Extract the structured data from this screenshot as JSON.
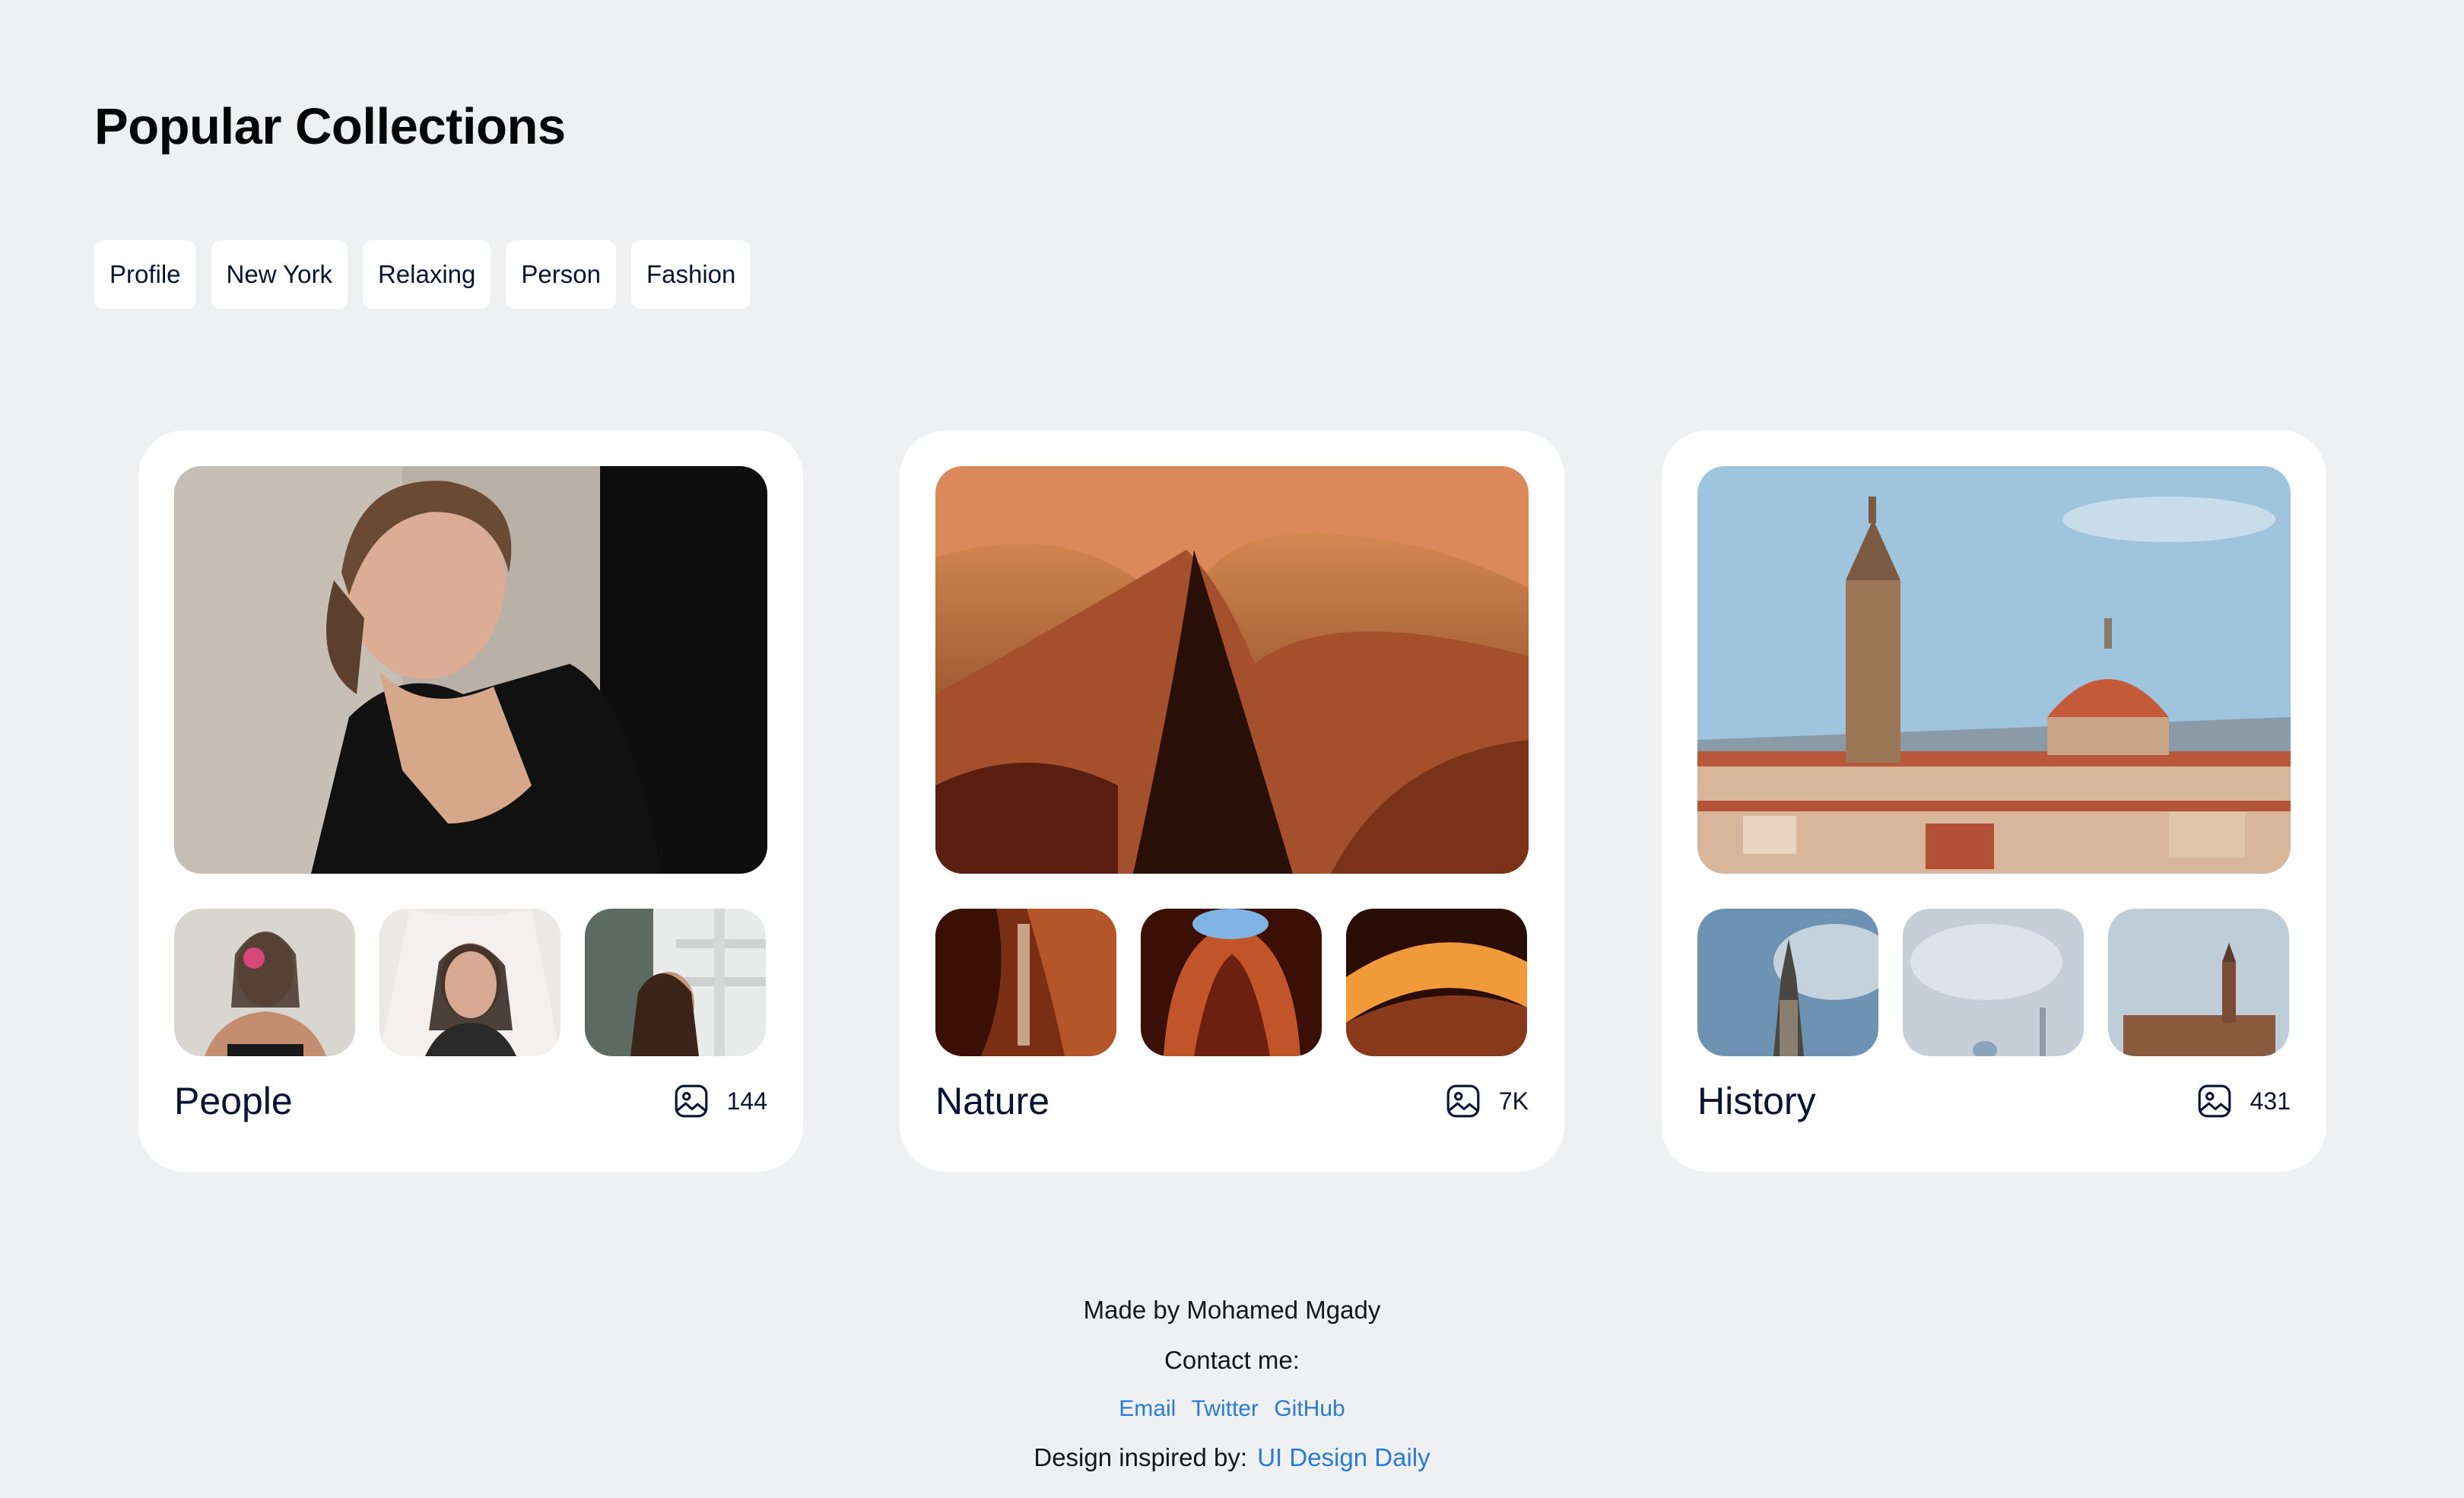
{
  "page": {
    "title": "Popular Collections"
  },
  "tags": [
    "Profile",
    "New York",
    "Relaxing",
    "Person",
    "Fashion"
  ],
  "collections": [
    {
      "name": "People",
      "count": "144",
      "icon": "image-icon"
    },
    {
      "name": "Nature",
      "count": "7K",
      "icon": "image-icon"
    },
    {
      "name": "History",
      "count": "431",
      "icon": "image-icon"
    }
  ],
  "footer": {
    "made_by": "Made by Mohamed Mgady",
    "contact": "Contact me:",
    "links": [
      "Email",
      "Twitter",
      "GitHub"
    ],
    "inspired_prefix": "Design inspired by:",
    "inspired_link": "UI Design Daily"
  },
  "colors": {
    "background": "#eff0f2",
    "card": "#ffffff",
    "text": "#0b1233",
    "link": "#2a7ad8"
  }
}
